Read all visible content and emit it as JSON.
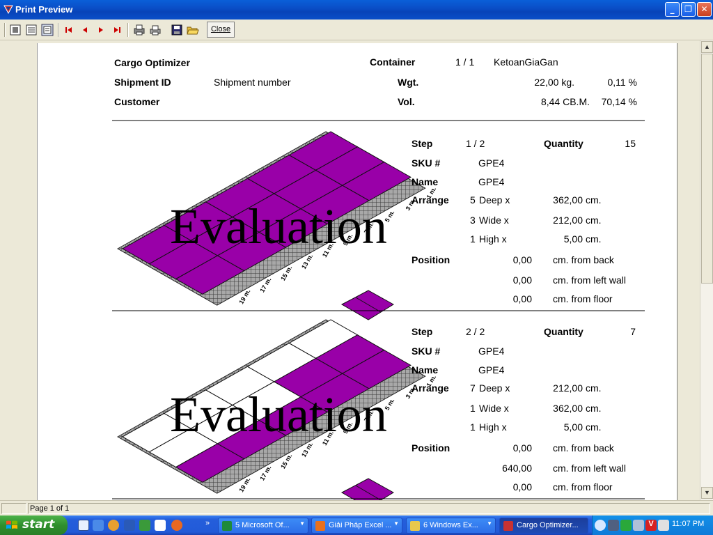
{
  "window": {
    "title": "Print Preview"
  },
  "toolbar": {
    "close_label": "Close"
  },
  "report": {
    "app_name": "Cargo Optimizer",
    "container_label": "Container",
    "container_index": "1 / 1",
    "container_name": "KetoanGiaGan",
    "shipment_label": "Shipment ID",
    "shipment_value": "Shipment number",
    "weight_label": "Wgt.",
    "weight_value": "22,00 kg.",
    "weight_pct": "0,11 %",
    "customer_label": "Customer",
    "volume_label": "Vol.",
    "volume_value": "8,44 CB.M.",
    "volume_pct": "70,14 %",
    "watermark": "Evaluation",
    "labels": {
      "step": "Step",
      "quantity": "Quantity",
      "sku": "SKU #",
      "name": "Name",
      "arrange": "Arrange",
      "position": "Position",
      "deep": "Deep x",
      "wide": "Wide x",
      "high": "High  x",
      "cm": "cm.",
      "from_back": "cm.  from back",
      "from_left": "cm.  from left wall",
      "from_floor": "cm.  from floor"
    },
    "steps": [
      {
        "step": "1  /   2",
        "quantity": "15",
        "sku": "GPE4",
        "name": "GPE4",
        "deep_n": "5",
        "deep_v": "362,00",
        "wide_n": "3",
        "wide_v": "212,00",
        "high_n": "1",
        "high_v": "5,00",
        "pos_back": "0,00",
        "pos_left": "0,00",
        "pos_floor": "0,00"
      },
      {
        "step": "2  /   2",
        "quantity": "7",
        "sku": "GPE4",
        "name": "GPE4",
        "deep_n": "7",
        "deep_v": "212,00",
        "wide_n": "1",
        "wide_v": "362,00",
        "high_n": "1",
        "high_v": "5,00",
        "pos_back": "0,00",
        "pos_left": "640,00",
        "pos_floor": "0,00"
      }
    ],
    "axis_labels_right": [
      "1 m.",
      "3 m.",
      "5 m.",
      "7 m.",
      "9 m.",
      "11 m.",
      "13 m.",
      "15 m.",
      "17 m.",
      "19 m."
    ],
    "axis_labels_front": [
      "1 m.",
      "3 m.",
      "5 m.",
      "7 m.",
      "9 m.",
      "11 m.",
      "13 m.",
      "15 m.",
      "17 m.",
      "19 m."
    ],
    "colors": {
      "cargo": "#9900a8",
      "floor_grid": "#555555",
      "floor_fill": "#a8a8a8"
    }
  },
  "statusbar": {
    "page": "Page 1 of 1"
  },
  "taskbar": {
    "start_label": "start",
    "tasks": [
      {
        "label": "5 Microsoft Of...",
        "icon_color": "#1e8a3a"
      },
      {
        "label": "Giải Pháp Excel ...",
        "icon_color": "#e8701c"
      },
      {
        "label": "6 Windows Ex...",
        "icon_color": "#e8c84c"
      },
      {
        "label": "Cargo Optimizer...",
        "icon_color": "#c83232"
      }
    ],
    "clock": "11:07 PM"
  }
}
